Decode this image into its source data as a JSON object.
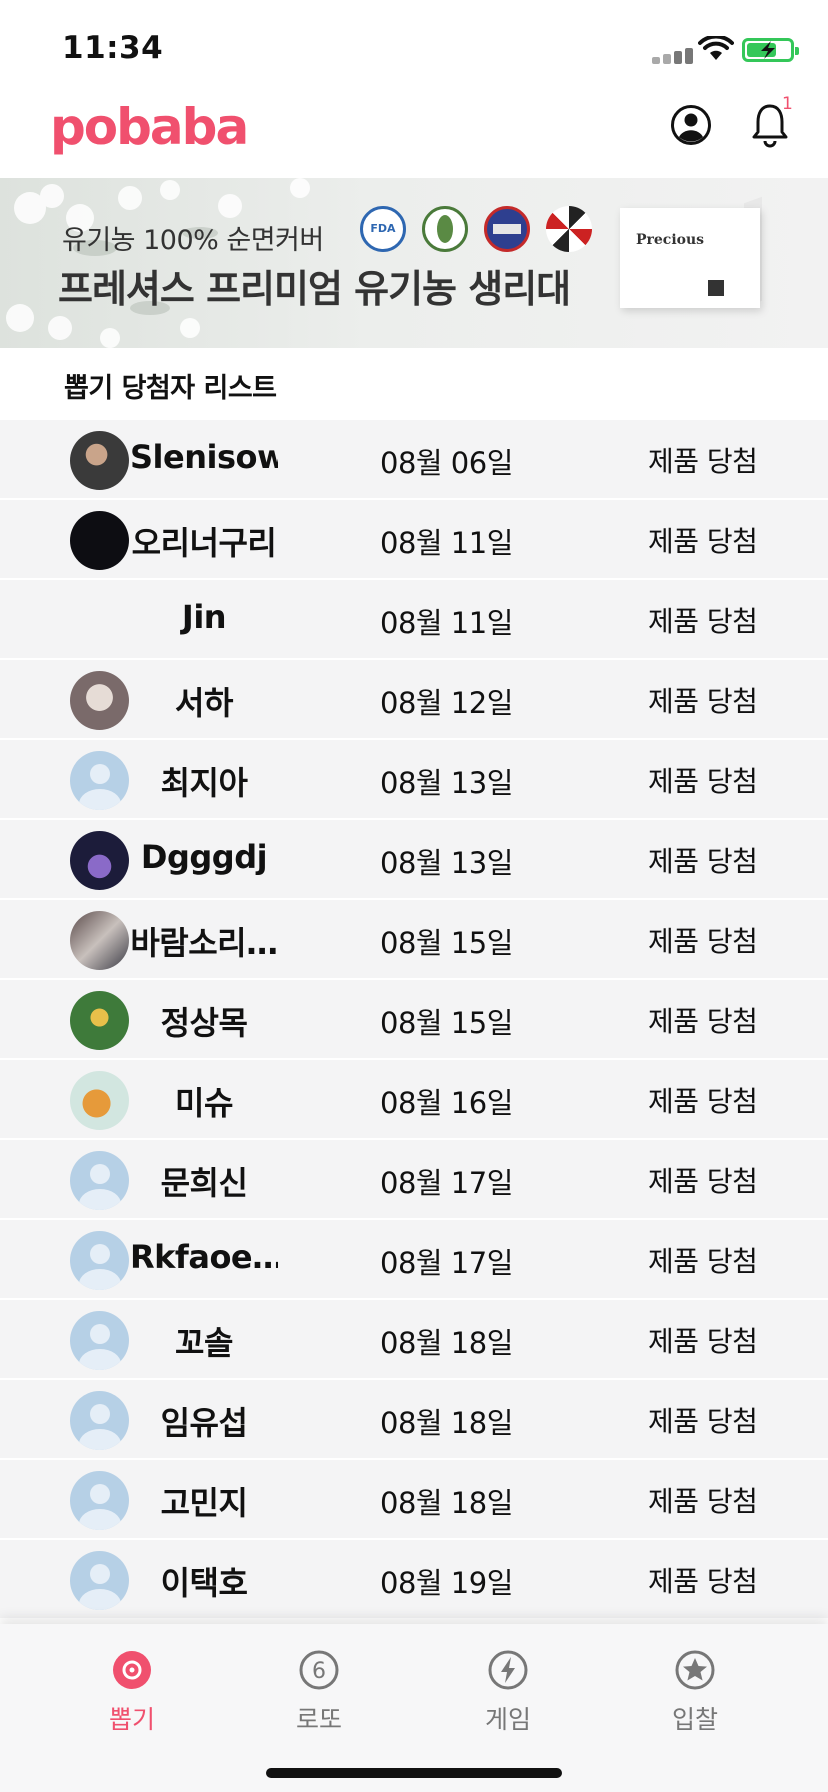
{
  "status_bar": {
    "time": "11:34"
  },
  "header": {
    "logo": "pobaba",
    "notification_count": "1"
  },
  "banner": {
    "subtitle": "유기농 100% 순면커버",
    "title": "프레셔스 프리미엄 유기농 생리대",
    "cert_fda": "FDA",
    "product_name": "Precious"
  },
  "list": {
    "title": "뽑기 당첨자 리스트",
    "rows": [
      {
        "name": "Slenisow",
        "date": "08월 06일",
        "result": "제품 당첨",
        "avatar": "photo"
      },
      {
        "name": "오리너구리",
        "date": "08월 11일",
        "result": "제품 당첨",
        "avatar": "black"
      },
      {
        "name": "Jin",
        "date": "08월 11일",
        "result": "제품 당첨",
        "avatar": "none"
      },
      {
        "name": "서하",
        "date": "08월 12일",
        "result": "제품 당첨",
        "avatar": "photo"
      },
      {
        "name": "최지아",
        "date": "08월 13일",
        "result": "제품 당첨",
        "avatar": "default"
      },
      {
        "name": "Dgggdj",
        "date": "08월 13일",
        "result": "제품 당첨",
        "avatar": "photo"
      },
      {
        "name": "바람소리…",
        "date": "08월 15일",
        "result": "제품 당첨",
        "avatar": "photo"
      },
      {
        "name": "정상목",
        "date": "08월 15일",
        "result": "제품 당첨",
        "avatar": "photo"
      },
      {
        "name": "미슈",
        "date": "08월 16일",
        "result": "제품 당첨",
        "avatar": "photo"
      },
      {
        "name": "문희신",
        "date": "08월 17일",
        "result": "제품 당첨",
        "avatar": "default"
      },
      {
        "name": "Rkfaoe…",
        "date": "08월 17일",
        "result": "제품 당첨",
        "avatar": "default"
      },
      {
        "name": "꼬솔",
        "date": "08월 18일",
        "result": "제품 당첨",
        "avatar": "default"
      },
      {
        "name": "임유섭",
        "date": "08월 18일",
        "result": "제품 당첨",
        "avatar": "default"
      },
      {
        "name": "고민지",
        "date": "08월 18일",
        "result": "제품 당첨",
        "avatar": "default"
      },
      {
        "name": "이택호",
        "date": "08월 19일",
        "result": "제품 당첨",
        "avatar": "default"
      }
    ]
  },
  "tabs": [
    {
      "label": "뽑기",
      "icon": "draw-disc-icon",
      "active": true
    },
    {
      "label": "로또",
      "icon": "lotto-ball-icon",
      "active": false
    },
    {
      "label": "게임",
      "icon": "lightning-icon",
      "active": false
    },
    {
      "label": "입찰",
      "icon": "star-icon",
      "active": false
    }
  ],
  "colors": {
    "brand": "#f0506e",
    "row_background": "#f4f4f5",
    "default_avatar": "#b6d0e6",
    "tab_inactive": "#777777"
  }
}
